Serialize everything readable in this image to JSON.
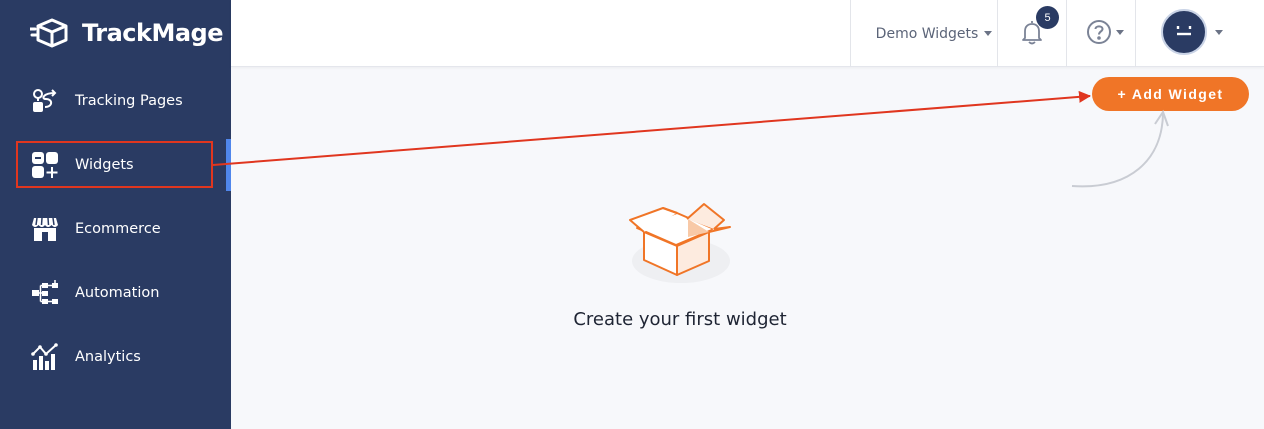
{
  "brand": {
    "name": "TrackMage",
    "color": "#2a3b63",
    "accent": "#f07527"
  },
  "sidebar": {
    "items": [
      {
        "label": "Tracking Pages",
        "icon": "tracking-pages-icon"
      },
      {
        "label": "Widgets",
        "icon": "widgets-icon",
        "active": true
      },
      {
        "label": "Ecommerce",
        "icon": "store-icon"
      },
      {
        "label": "Automation",
        "icon": "automation-icon"
      },
      {
        "label": "Analytics",
        "icon": "analytics-icon"
      }
    ]
  },
  "topbar": {
    "workspace": "Demo Widgets",
    "notifications_count": "5",
    "help_icon": "help-icon",
    "avatar_icon": "user-avatar-icon"
  },
  "main": {
    "add_button_label": "+ Add Widget",
    "empty_state_text": "Create your first widget",
    "empty_state_icon": "open-box-icon"
  }
}
